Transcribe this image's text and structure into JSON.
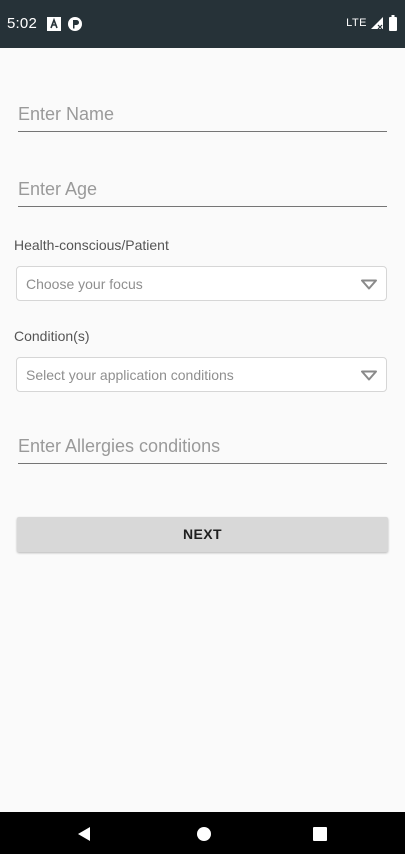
{
  "status_bar": {
    "time": "5:02",
    "network": "LTE",
    "icons": [
      "notification-a-icon",
      "app-notification-icon",
      "signal-icon",
      "battery-icon"
    ]
  },
  "form": {
    "name_placeholder": "Enter Name",
    "age_placeholder": "Enter Age",
    "focus_label": "Health-conscious/Patient",
    "focus_placeholder": "Choose your focus",
    "conditions_label": "Condition(s)",
    "conditions_placeholder": "Select your application conditions",
    "allergies_placeholder": "Enter Allergies conditions",
    "next_label": "NEXT"
  },
  "nav_bar": {
    "icons": [
      "back-icon",
      "home-icon",
      "recent-apps-icon"
    ]
  },
  "colors": {
    "status_bar": "#263238",
    "background": "#fafafa",
    "button": "#d8d8d8",
    "underline": "#757575",
    "nav_bar": "#000000"
  }
}
